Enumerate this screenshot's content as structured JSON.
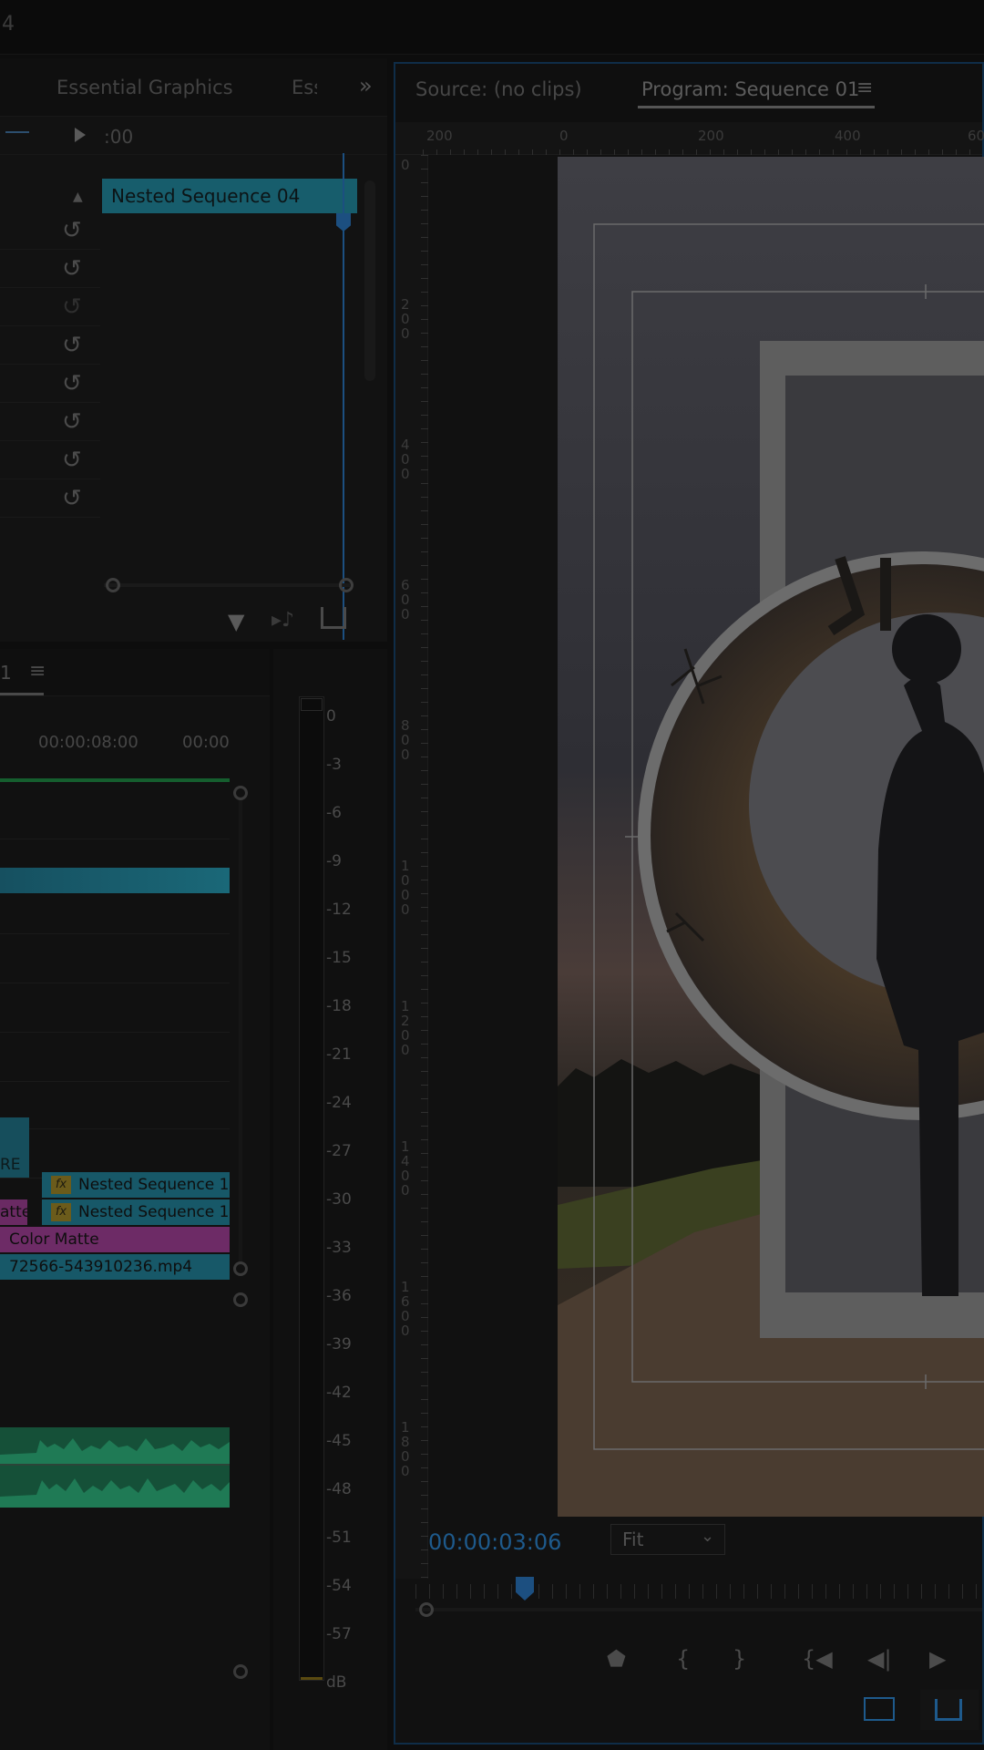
{
  "titlebar": {
    "text": "4"
  },
  "effect_controls": {
    "tabs": [
      "Essential Graphics",
      "Ess"
    ],
    "more_icon": "double-chevron-right-icon",
    "time_label": ":00",
    "clip_name": "Nested Sequence 04",
    "reset_icon": "reset-icon"
  },
  "monitor_tabs": {
    "source": "Source: (no clips)",
    "program": "Program: Sequence 01"
  },
  "ruler": {
    "h": [
      "200",
      "0",
      "200",
      "400",
      "60"
    ],
    "v": [
      "0",
      "200",
      "400",
      "600",
      "800",
      "1000",
      "1200",
      "1400",
      "1600",
      "1800"
    ]
  },
  "timeline": {
    "tab": "1",
    "timecodes": [
      "00:00:08:00",
      "00:00"
    ],
    "clips": {
      "re": "RE",
      "nested1": "Nested Sequence 1",
      "nested2": "Nested Sequence 1",
      "matte_left": "atte",
      "color_matte": "Color Matte",
      "video": "72566-543910236.mp4"
    }
  },
  "meter": {
    "ticks": [
      "0",
      "-3",
      "-6",
      "-9",
      "-12",
      "-15",
      "-18",
      "-21",
      "-24",
      "-27",
      "-30",
      "-33",
      "-36",
      "-39",
      "-42",
      "-45",
      "-48",
      "-51",
      "-54",
      "-57",
      "dB"
    ]
  },
  "program": {
    "timecode": "00:00:03:06",
    "zoom": "Fit"
  },
  "colors": {
    "accent": "#1e5a8c",
    "clip_teal": "#1a6e82",
    "clip_pink": "#7a2f70",
    "audio_green": "#1c6b48"
  }
}
